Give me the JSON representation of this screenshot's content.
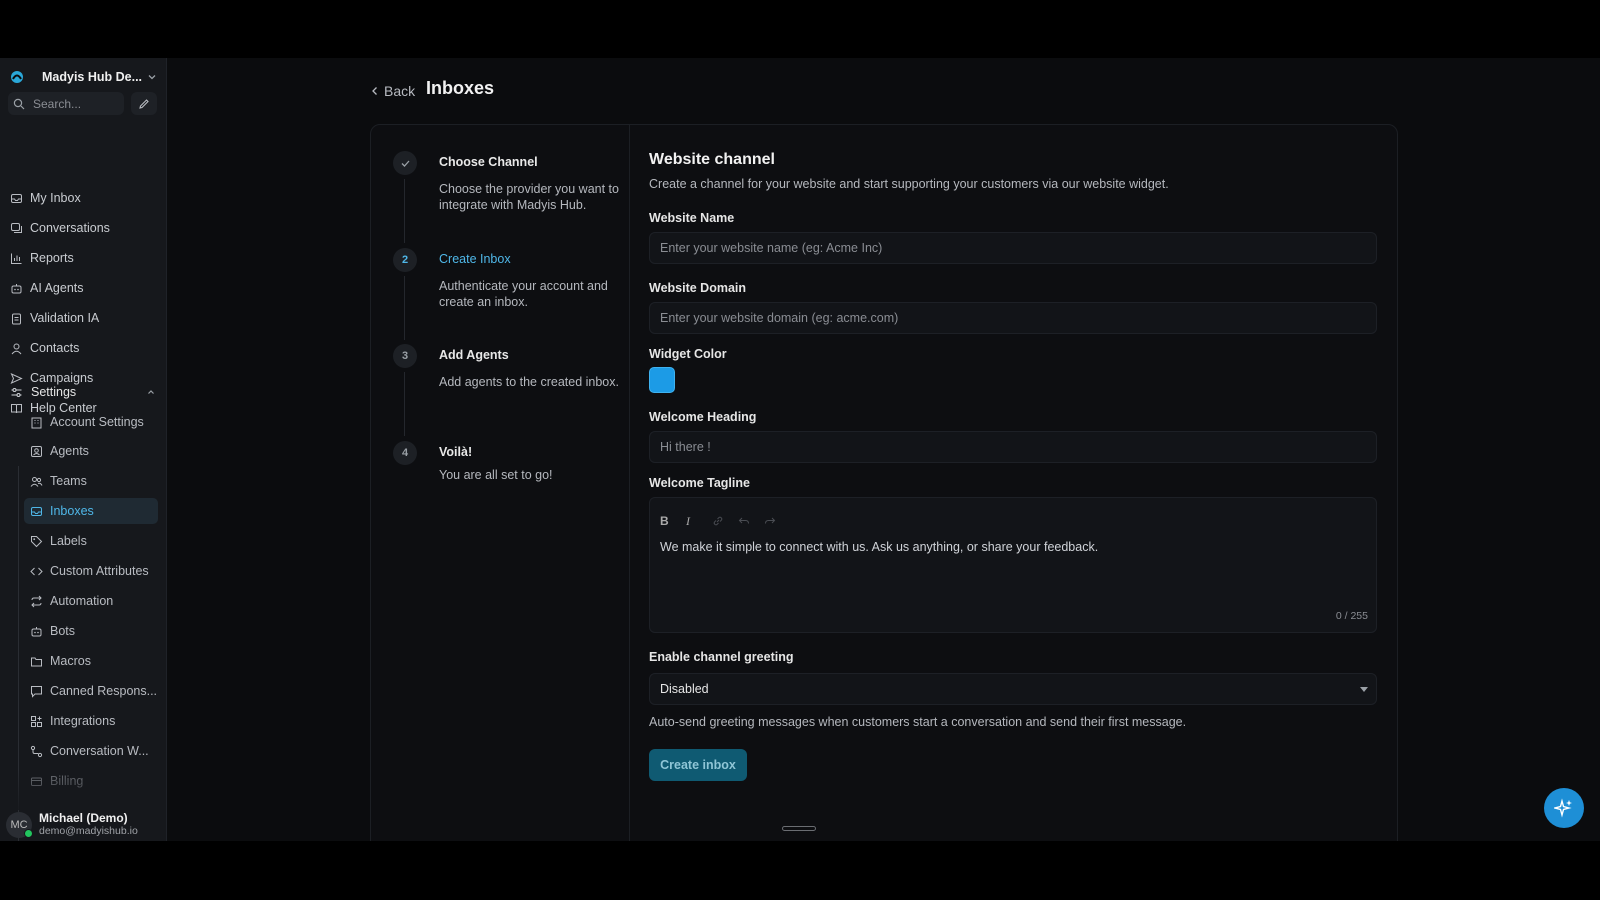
{
  "workspace": {
    "name": "Madyis Hub De..."
  },
  "search": {
    "placeholder": "Search..."
  },
  "nav": [
    {
      "label": "My Inbox",
      "icon": "inbox-icon"
    },
    {
      "label": "Conversations",
      "icon": "chat-icon"
    },
    {
      "label": "Reports",
      "icon": "bar-chart-icon"
    },
    {
      "label": "AI Agents",
      "icon": "robot-icon"
    },
    {
      "label": "Validation IA",
      "icon": "clipboard-icon"
    },
    {
      "label": "Contacts",
      "icon": "person-icon"
    },
    {
      "label": "Campaigns",
      "icon": "send-icon"
    },
    {
      "label": "Help Center",
      "icon": "book-icon"
    }
  ],
  "settings": {
    "label": "Settings",
    "items": [
      {
        "label": "Account Settings",
        "icon": "building-icon"
      },
      {
        "label": "Agents",
        "icon": "agent-icon"
      },
      {
        "label": "Teams",
        "icon": "team-icon"
      },
      {
        "label": "Inboxes",
        "icon": "inbox-icon",
        "active": true
      },
      {
        "label": "Labels",
        "icon": "tag-icon"
      },
      {
        "label": "Custom Attributes",
        "icon": "code-icon"
      },
      {
        "label": "Automation",
        "icon": "repeat-icon"
      },
      {
        "label": "Bots",
        "icon": "robot-icon"
      },
      {
        "label": "Macros",
        "icon": "folder-icon"
      },
      {
        "label": "Canned Respons...",
        "icon": "message-icon"
      },
      {
        "label": "Integrations",
        "icon": "grid-icon"
      },
      {
        "label": "Conversation W...",
        "icon": "workflow-icon"
      },
      {
        "label": "Billing",
        "icon": "card-icon"
      }
    ]
  },
  "user": {
    "initials": "MC",
    "name": "Michael (Demo)",
    "email": "demo@madyishub.io"
  },
  "header": {
    "back_label": "Back",
    "title": "Inboxes"
  },
  "steps": [
    {
      "number": "✓",
      "title": "Choose Channel",
      "desc": "Choose the provider you want to integrate with Madyis Hub."
    },
    {
      "number": "2",
      "title": "Create Inbox",
      "desc": "Authenticate your account and create an inbox.",
      "active": true
    },
    {
      "number": "3",
      "title": "Add Agents",
      "desc": "Add agents to the created inbox."
    },
    {
      "number": "4",
      "title": "Voilà!",
      "desc": "You are all set to go!"
    }
  ],
  "form": {
    "title": "Website channel",
    "subtitle": "Create a channel for your website and start supporting your customers via our website widget.",
    "website_name": {
      "label": "Website Name",
      "placeholder": "Enter your website name (eg: Acme Inc)",
      "value": ""
    },
    "website_domain": {
      "label": "Website Domain",
      "placeholder": "Enter your website domain (eg: acme.com)",
      "value": ""
    },
    "widget_color": {
      "label": "Widget Color",
      "value": "#1c9be6"
    },
    "welcome_heading": {
      "label": "Welcome Heading",
      "placeholder": "Hi there !",
      "value": ""
    },
    "welcome_tagline": {
      "label": "Welcome Tagline",
      "toolbar": [
        "B",
        "I",
        "link",
        "undo",
        "redo"
      ],
      "text": "We make it simple to connect with us. Ask us anything, or share your feedback.",
      "counter": "0 / 255"
    },
    "channel_greeting": {
      "label": "Enable channel greeting",
      "value": "Disabled",
      "help": "Auto-send greeting messages when customers start a conversation and send their first message."
    },
    "submit_label": "Create inbox"
  },
  "colors": {
    "accent": "#4fb7e8",
    "button": "#0f5a72",
    "fab": "#1e8fd6",
    "online": "#22c55e"
  }
}
